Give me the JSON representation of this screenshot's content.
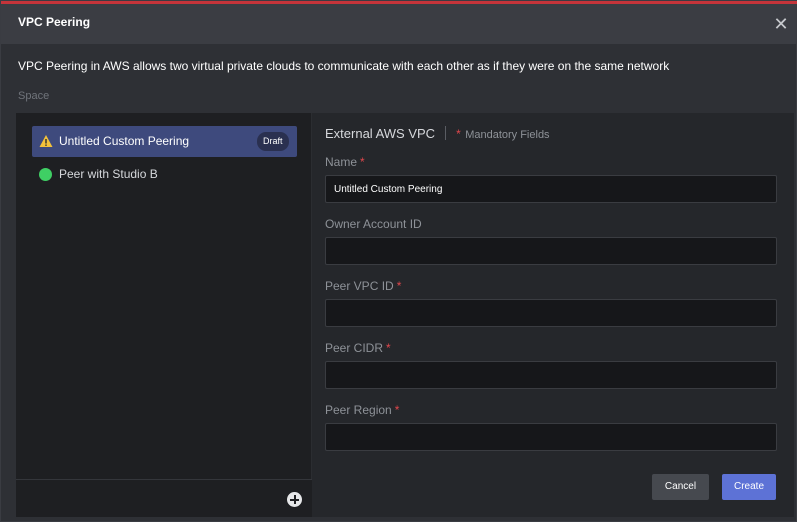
{
  "dialog": {
    "title": "VPC Peering",
    "close_icon": "close-icon",
    "description": "VPC Peering in AWS allows two virtual private clouds to communicate with each other as if they were on the same network",
    "space_label": "Space"
  },
  "peer_list": {
    "items": [
      {
        "label": "Untitled Custom Peering",
        "icon": "warning-icon",
        "badge": "Draft",
        "selected": true
      },
      {
        "label": "Peer with Studio B",
        "icon": "status-dot-green",
        "status_color": "#3fcf64",
        "selected": false
      }
    ],
    "add_icon": "add-circle-icon"
  },
  "form": {
    "section_title": "External AWS VPC",
    "required_marker": "*",
    "mandatory_note": "Mandatory Fields",
    "fields": [
      {
        "label": "Name",
        "required": true,
        "value": "Untitled Custom Peering"
      },
      {
        "label": "Owner Account ID",
        "required": false,
        "value": ""
      },
      {
        "label": "Peer VPC ID",
        "required": true,
        "value": ""
      },
      {
        "label": "Peer CIDR",
        "required": true,
        "value": ""
      },
      {
        "label": "Peer Region",
        "required": true,
        "value": ""
      }
    ],
    "cancel_label": "Cancel",
    "create_label": "Create"
  },
  "colors": {
    "accent": "#c5343a",
    "primary_button": "#5d72d6",
    "selected_item": "#3e4a7d",
    "required": "#e0474c"
  }
}
